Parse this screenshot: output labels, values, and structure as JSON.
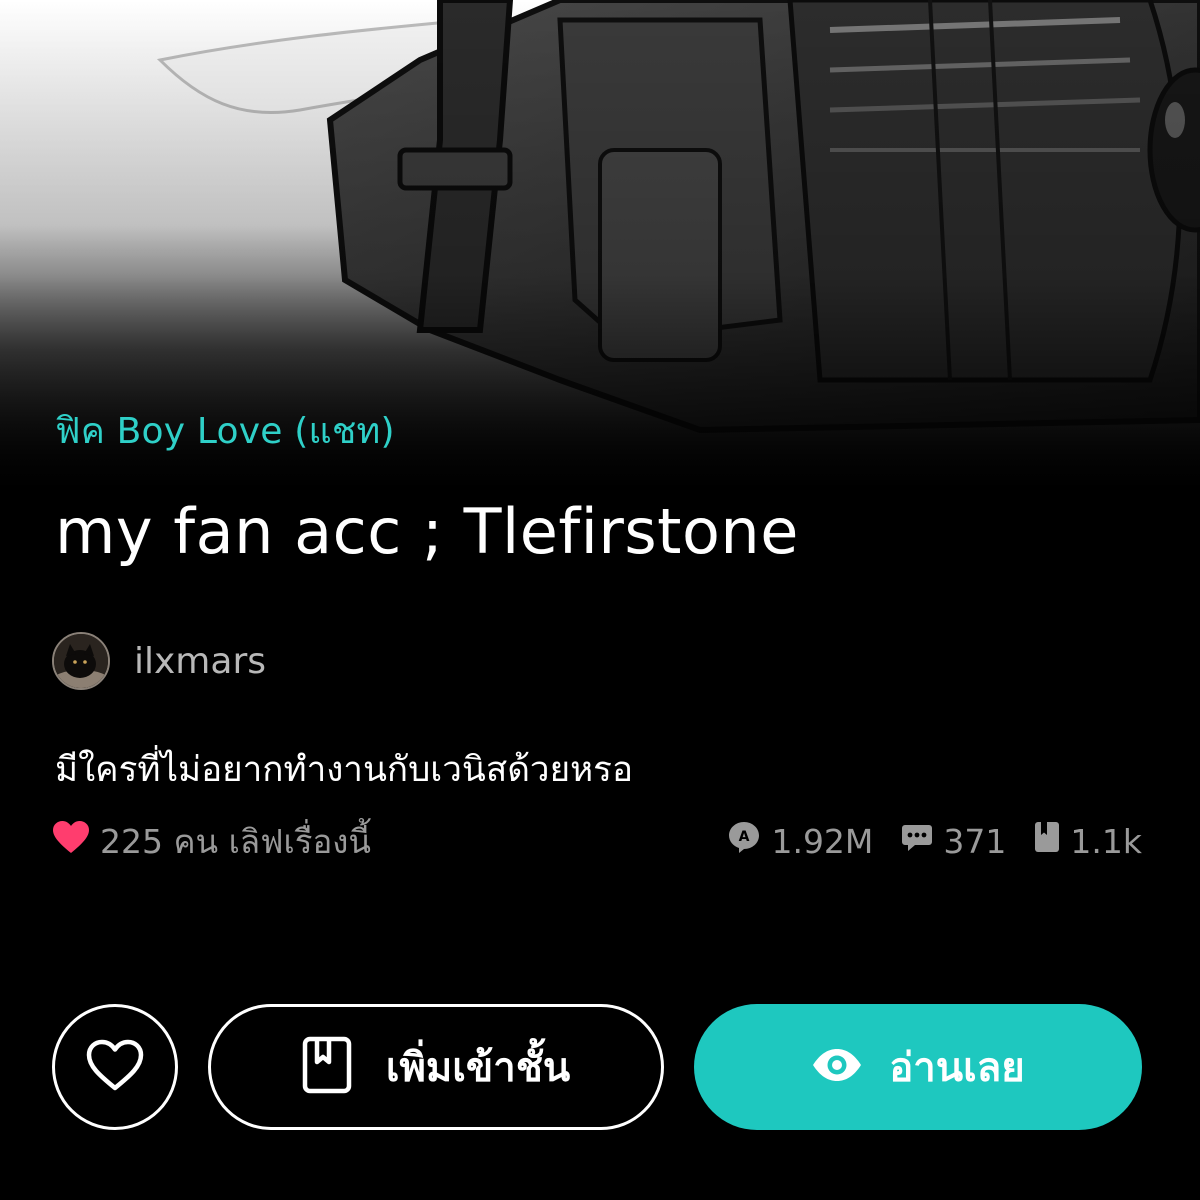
{
  "story": {
    "category": "ฟิค Boy Love (แชท)",
    "title": "my fan acc ; Tlefirstone",
    "author": "ilxmars",
    "description": "มีใครที่ไม่อยากทำงานกับเวนิสด้วยหรอ"
  },
  "stats": {
    "likes_text": "225 คน เลิฟเรื่องนี้",
    "views": "1.92M",
    "comments": "371",
    "chapters": "1.1k"
  },
  "actions": {
    "add_to_shelf_label": "เพิ่มเข้าชั้น",
    "read_now_label": "อ่านเลย"
  },
  "icons": {
    "heart": "heart-icon",
    "views": "view-count-icon",
    "comments": "comment-icon",
    "chapters": "book-icon",
    "shelf": "bookmark-icon",
    "read": "eye-icon"
  },
  "colors": {
    "accent": "#1ec8bf",
    "category": "#2fd0c8",
    "heart": "#ff3d6e",
    "muted": "#9a9a9a",
    "background": "#000000"
  }
}
